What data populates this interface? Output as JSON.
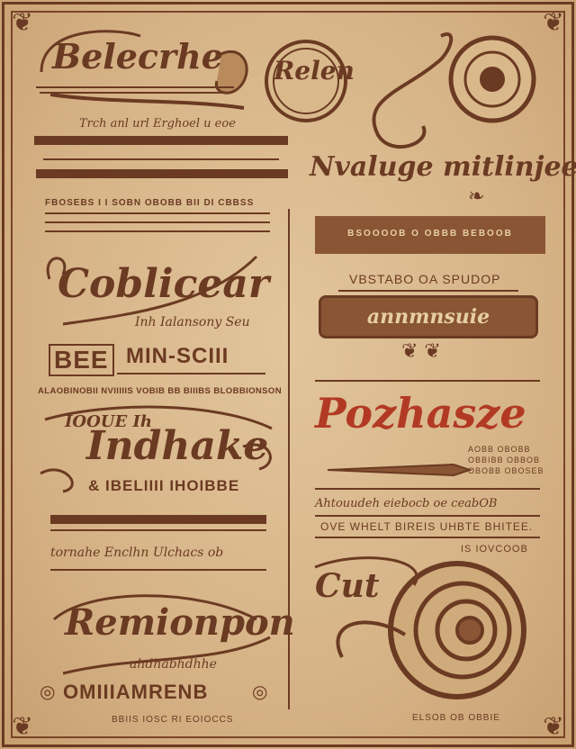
{
  "left_column": {
    "heading_1": "Belecrhe",
    "tagline_1": "Trch anl url Erghoel u eoe",
    "caps_row_1": "FBOSEBS I I SOBN OBOBB BII DI CBBSS",
    "heading_2": "Coblicear",
    "subtext_2": "Inh Ialansony Seu",
    "block_left": "BEE",
    "block_right": "MIN-SCIII",
    "caps_row_2": "ALAOBINOBII NVIIIIIS VOBIB BB BIIIBS BLOBBIONSON",
    "heading_3_small": "IOOUE Ih",
    "heading_3": "Indhake",
    "subtext_3": "& IBELIIII IHOIBBE",
    "script_row": "tornahe  Enclhn  Ulchacs ob",
    "heading_4": "Remionpon",
    "subtext_4": "ahdhabhdhhe",
    "block_bottom": "OMIIIAMRENB",
    "footer_caps": "BBIIS IOSC RI EOIOCCS"
  },
  "right_column": {
    "badge_1": "Relen",
    "heading_1": "Nvaluge mitlinjee",
    "band_1": "BSOOOOB O OBBB BEBOOB",
    "caps_row_1": "VBSTABO OA SPUDOP",
    "label_box": "annmnsuie",
    "heading_2": "Pozhasze",
    "caps_small_2a": "AOBB OBOBB",
    "caps_small_2b": "OBBIBB OBBOB",
    "caps_small_2c": "OBOBB OBOSEB",
    "script_row_2": "Ahtouudeh  eiebocb oe  ceabOB",
    "caps_row_2": "OVE  WHELT BIREIS UHBTE BHITEE.",
    "caps_small_3": "IS IOVCOOB",
    "heading_3": "Cut",
    "footer_caps": "ELSOB OB OBBIE"
  },
  "colors": {
    "ink": "#6b3a22",
    "paper": "#d9b98c",
    "accent_red": "#b23a24"
  }
}
